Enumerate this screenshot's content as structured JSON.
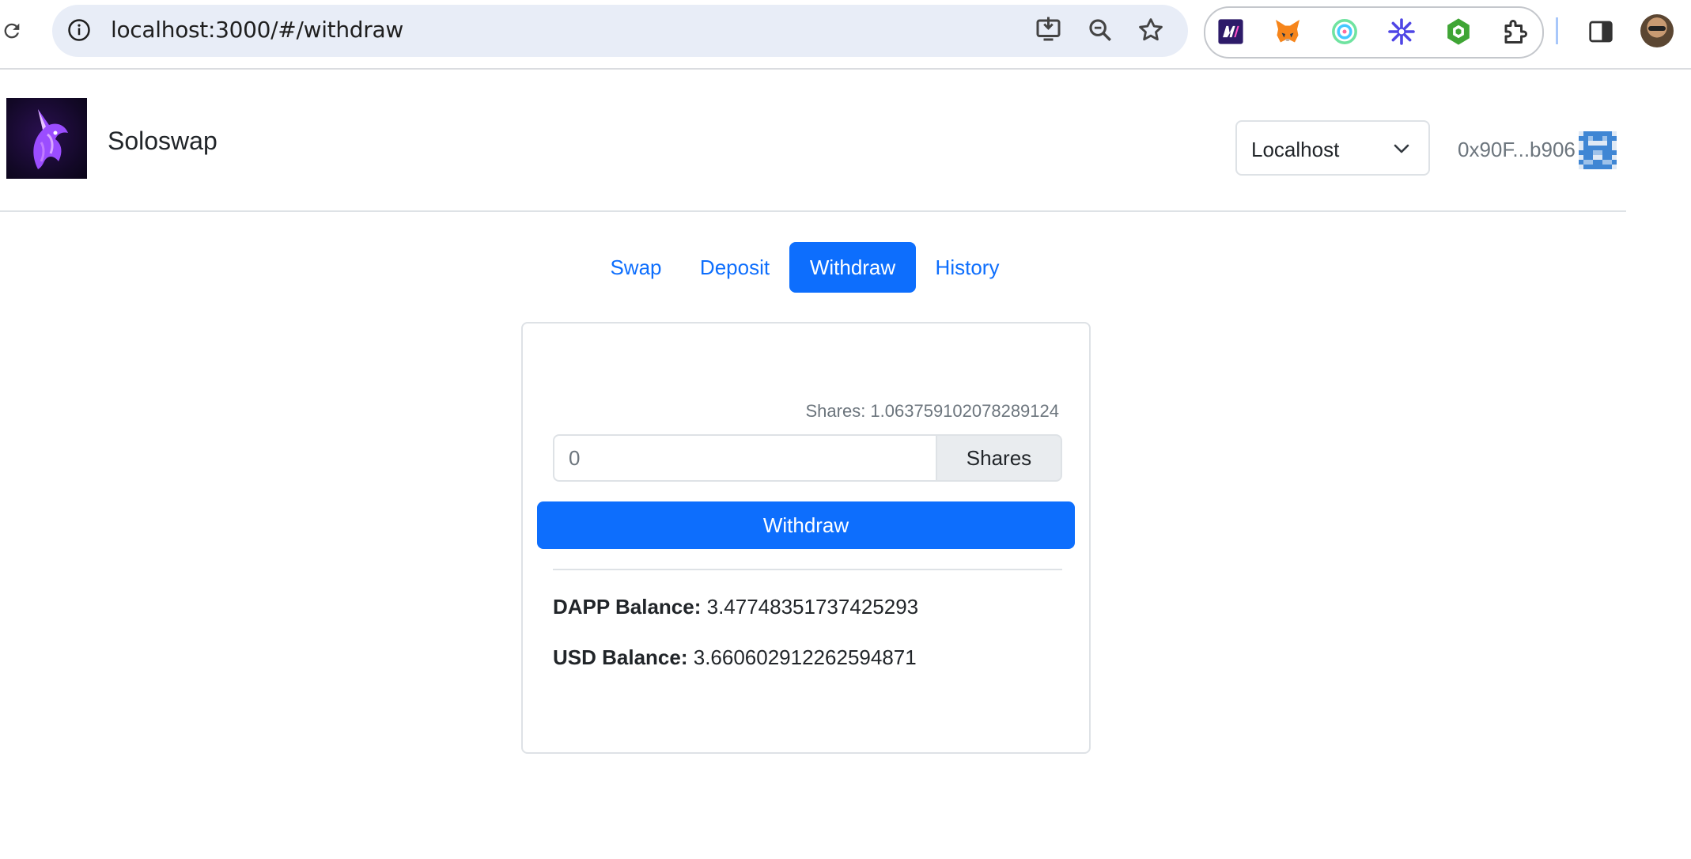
{
  "browser": {
    "url": "localhost:3000/#/withdraw",
    "icons": {
      "reload": "reload-icon",
      "site_info": "info-icon",
      "install": "install-app-icon",
      "zoom": "zoom-out-icon",
      "bookmark": "star-icon",
      "extensions_menu": "puzzle-icon",
      "side_panel": "side-panel-icon"
    },
    "extensions": [
      "m-extension-icon",
      "metamask-fox-icon",
      "target-ring-icon",
      "asterisk-icon",
      "green-hexagon-icon"
    ]
  },
  "header": {
    "brand": "Soloswap",
    "network_selected": "Localhost",
    "account": "0x90F...b906"
  },
  "tabs": [
    {
      "label": "Swap",
      "active": false
    },
    {
      "label": "Deposit",
      "active": false
    },
    {
      "label": "Withdraw",
      "active": true
    },
    {
      "label": "History",
      "active": false
    }
  ],
  "withdraw_card": {
    "shares_hint": "Shares: 1.063759102078289124",
    "amount_placeholder": "0",
    "addon_label": "Shares",
    "button_label": "Withdraw",
    "dapp_balance_label": "DAPP Balance:",
    "dapp_balance_value": "3.47748351737425293",
    "usd_balance_label": "USD Balance:",
    "usd_balance_value": "3.660602912262594871"
  },
  "colors": {
    "primary": "#0d6efd",
    "muted": "#6c757d",
    "border": "#dee2e6"
  }
}
